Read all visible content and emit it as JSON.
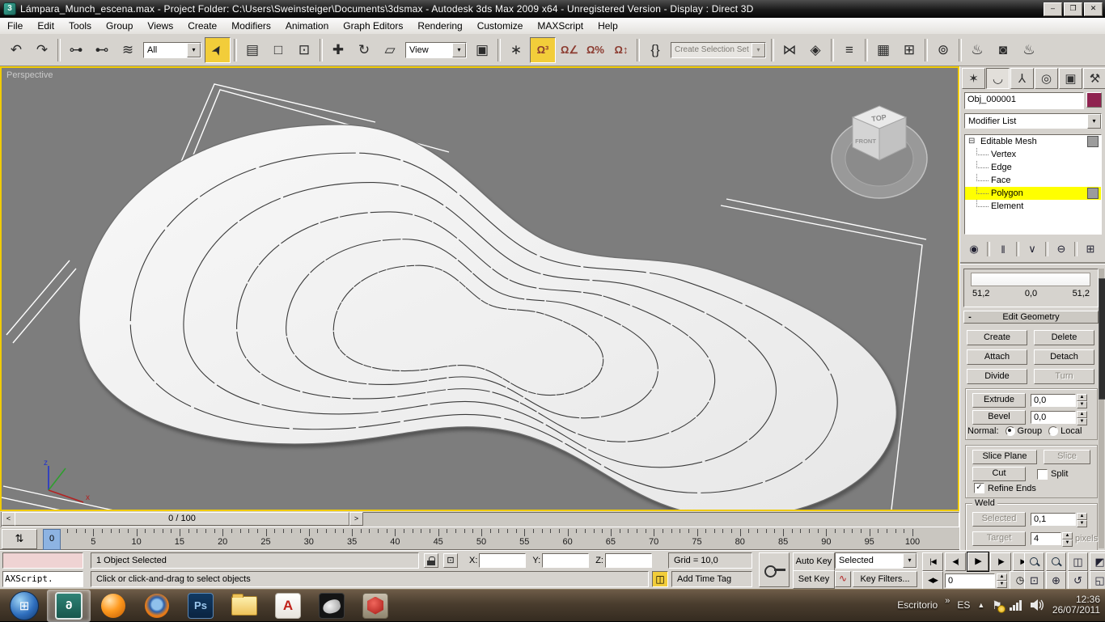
{
  "window": {
    "title": "Lámpara_Munch_escena.max      - Project Folder: C:\\Users\\Sweinsteiger\\Documents\\3dsmax      - Autodesk 3ds Max  2009 x64  - Unregistered Version      - Display : Direct 3D",
    "buttons": {
      "minimize": "–",
      "maximize": "❐",
      "close": "✕"
    }
  },
  "menu": [
    "File",
    "Edit",
    "Tools",
    "Group",
    "Views",
    "Create",
    "Modifiers",
    "Animation",
    "Graph Editors",
    "Rendering",
    "Customize",
    "MAXScript",
    "Help"
  ],
  "toolbar": {
    "items": [
      {
        "type": "icon",
        "name": "undo-icon",
        "glyph": "↶"
      },
      {
        "type": "icon",
        "name": "redo-icon",
        "glyph": "↷"
      },
      {
        "type": "sep"
      },
      {
        "type": "icon",
        "name": "select-and-link-icon",
        "glyph": "⊶"
      },
      {
        "type": "icon",
        "name": "unlink-selection-icon",
        "glyph": "⊷"
      },
      {
        "type": "icon",
        "name": "bind-to-space-warp-icon",
        "glyph": "≋"
      },
      {
        "type": "dropdown",
        "name": "selection-filter-dropdown",
        "value": "All"
      },
      {
        "type": "icon",
        "name": "select-object-icon",
        "glyph": "➤",
        "active": true
      },
      {
        "type": "sep"
      },
      {
        "type": "icon",
        "name": "select-by-name-icon",
        "glyph": "▤"
      },
      {
        "type": "icon",
        "name": "rectangular-selection-region-icon",
        "glyph": "□"
      },
      {
        "type": "icon",
        "name": "window-crossing-icon",
        "glyph": "⊡"
      },
      {
        "type": "sep"
      },
      {
        "type": "icon",
        "name": "select-and-move-icon",
        "glyph": "✚"
      },
      {
        "type": "icon",
        "name": "select-and-rotate-icon",
        "glyph": "↻"
      },
      {
        "type": "icon",
        "name": "select-and-scale-icon",
        "glyph": "▱"
      },
      {
        "type": "dropdown",
        "name": "reference-coordinate-dropdown",
        "value": "View"
      },
      {
        "type": "icon",
        "name": "use-pivot-point-icon",
        "glyph": "▣"
      },
      {
        "type": "sep"
      },
      {
        "type": "icon",
        "name": "select-and-manipulate-icon",
        "glyph": "∗"
      },
      {
        "type": "icon",
        "name": "snap-toggle-3d-icon",
        "glyph": "Ω³",
        "active": true
      },
      {
        "type": "icon",
        "name": "angle-snap-icon",
        "glyph": "Ω∠"
      },
      {
        "type": "icon",
        "name": "percent-snap-icon",
        "glyph": "Ω%"
      },
      {
        "type": "icon",
        "name": "spinner-snap-icon",
        "glyph": "Ω↕"
      },
      {
        "type": "sep"
      },
      {
        "type": "icon",
        "name": "named-selection-sets-icon",
        "glyph": "{}"
      },
      {
        "type": "input",
        "name": "create-selection-set-input",
        "placeholder": "Create Selection Set"
      },
      {
        "type": "sep"
      },
      {
        "type": "icon",
        "name": "mirror-icon",
        "glyph": "⋈"
      },
      {
        "type": "icon",
        "name": "align-icon",
        "glyph": "◈"
      },
      {
        "type": "sep"
      },
      {
        "type": "icon",
        "name": "layer-manager-icon",
        "glyph": "≡"
      },
      {
        "type": "sep"
      },
      {
        "type": "icon",
        "name": "curve-editor-icon",
        "glyph": "▦"
      },
      {
        "type": "icon",
        "name": "schematic-view-icon",
        "glyph": "⊞"
      },
      {
        "type": "sep"
      },
      {
        "type": "icon",
        "name": "material-editor-icon",
        "glyph": "⊚"
      },
      {
        "type": "sep"
      },
      {
        "type": "icon",
        "name": "render-setup-icon",
        "glyph": "♨"
      },
      {
        "type": "icon",
        "name": "rendered-frame-window-icon",
        "glyph": "◙"
      },
      {
        "type": "icon",
        "name": "quick-render-icon",
        "glyph": "♨"
      }
    ]
  },
  "viewport": {
    "label": "Perspective",
    "viewcube_top": "TOP",
    "viewcube_front": "FRONT",
    "axis_x": "x",
    "axis_z": "z"
  },
  "command_panel": {
    "tabs": [
      {
        "name": "tab-create-icon",
        "glyph": "✶"
      },
      {
        "name": "tab-modify-icon",
        "glyph": "◡"
      },
      {
        "name": "tab-hierarchy-icon",
        "glyph": "⅄"
      },
      {
        "name": "tab-motion-icon",
        "glyph": "◎"
      },
      {
        "name": "tab-display-icon",
        "glyph": "▣"
      },
      {
        "name": "tab-utilities-icon",
        "glyph": "⚒"
      }
    ],
    "object_name": "Obj_000001",
    "modifier_list": "Modifier List",
    "stack": {
      "root": "Editable Mesh",
      "items": [
        "Vertex",
        "Edge",
        "Face",
        "Polygon",
        "Element"
      ],
      "selected": "Polygon"
    },
    "stack_tools": [
      {
        "name": "pin-stack-icon",
        "glyph": "◉"
      },
      {
        "name": "show-end-result-icon",
        "glyph": "‖"
      },
      {
        "name": "make-unique-icon",
        "glyph": "∨"
      },
      {
        "name": "remove-modifier-icon",
        "glyph": "⊖"
      },
      {
        "name": "configure-modifier-sets-icon",
        "glyph": "⊞"
      }
    ],
    "soft_values": [
      "51,2",
      "0,0",
      "51,2"
    ],
    "rollout_title": "Edit Geometry",
    "buttons": {
      "create": "Create",
      "delete": "Delete",
      "attach": "Attach",
      "detach": "Detach",
      "divide": "Divide",
      "turn": "Turn",
      "extrude": "Extrude",
      "bevel": "Bevel",
      "slice_plane": "Slice Plane",
      "slice": "Slice",
      "cut": "Cut"
    },
    "fields": {
      "extrude_value": "0,0",
      "bevel_value": "0,0",
      "weld_selected_value": "0,1",
      "weld_target_value": "4"
    },
    "labels": {
      "normal": "Normal:",
      "group": "Group",
      "local": "Local",
      "split": "Split",
      "refine_ends": "Refine Ends",
      "weld": "Weld",
      "weld_selected": "Selected",
      "weld_target": "Target",
      "pixels": "pixels"
    }
  },
  "timeline": {
    "slider": "0 / 100",
    "prev": "<",
    "next": ">",
    "frames": 100,
    "label_step": 5,
    "current": "0"
  },
  "status": {
    "listener": "AXScript.",
    "selected": "1 Object Selected",
    "prompt": "Click or click-and-drag to select objects",
    "x": "X:",
    "y": "Y:",
    "z": "Z:",
    "grid": "Grid = 10,0",
    "add_time_tag": "Add Time Tag",
    "time_tag_glyph": "◫"
  },
  "anim": {
    "auto_key": "Auto Key",
    "set_key": "Set Key",
    "selected_filter": "Selected",
    "key_filters": "Key Filters...",
    "frame_value": "0",
    "playback": [
      {
        "name": "go-to-start-icon",
        "glyph": "|◀"
      },
      {
        "name": "previous-frame-icon",
        "glyph": "◀|"
      },
      {
        "name": "play-icon",
        "glyph": "▶"
      },
      {
        "name": "next-frame-icon",
        "glyph": "|▶"
      },
      {
        "name": "go-to-end-icon",
        "glyph": "▶|"
      }
    ],
    "key_mode_glyph": "◀▶",
    "time_config_glyph": "◷",
    "curve_glyph": "∿"
  },
  "nav": {
    "icons": [
      {
        "name": "zoom-icon",
        "css": "mag"
      },
      {
        "name": "zoom-all-icon",
        "css": "mag"
      },
      {
        "name": "zoom-extents-icon",
        "glyph": "◫"
      },
      {
        "name": "zoom-extents-all-icon",
        "glyph": "◩"
      },
      {
        "name": "zoom-region-icon",
        "glyph": "⊡"
      },
      {
        "name": "pan-view-icon",
        "glyph": "⊕"
      },
      {
        "name": "arc-rotate-icon",
        "glyph": "↺"
      },
      {
        "name": "min-max-toggle-icon",
        "glyph": "◱"
      }
    ]
  },
  "taskbar": {
    "apps": [
      {
        "name": "start-button"
      },
      {
        "name": "taskbar-3dsmax",
        "active": true,
        "label": "6"
      },
      {
        "name": "taskbar-gom-player"
      },
      {
        "name": "taskbar-firefox"
      },
      {
        "name": "taskbar-photoshop",
        "label": "Ps"
      },
      {
        "name": "taskbar-explorer"
      },
      {
        "name": "taskbar-autocad",
        "label": "A"
      },
      {
        "name": "taskbar-rhino"
      },
      {
        "name": "taskbar-red-app"
      }
    ],
    "tray": {
      "desktop": "Escritorio",
      "chevron": "»",
      "lang": "ES",
      "hidden_icons": "▲",
      "time": "12:36",
      "date": "26/07/2011"
    }
  },
  "colors": {
    "accent_yellow": "#f2cd3a",
    "viewport_border": "#f0cb05",
    "polygon_highlight": "#ffff00",
    "object_color": "#8f2350",
    "viewport_bg": "#7d7d7d"
  }
}
